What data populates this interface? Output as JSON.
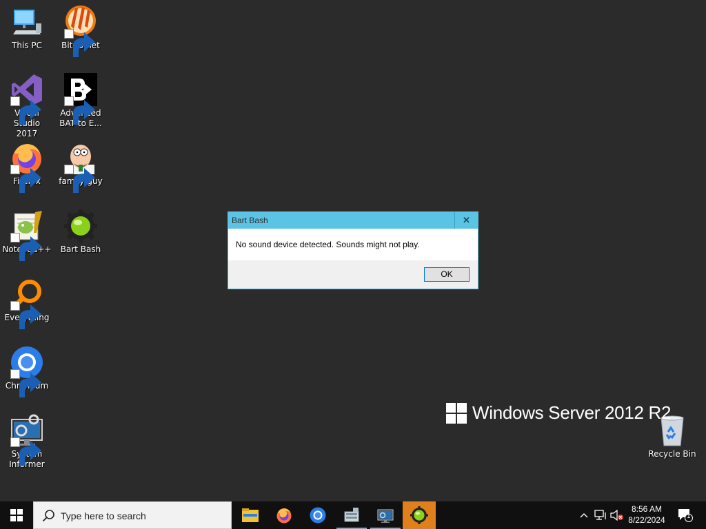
{
  "desktop": {
    "icons": [
      {
        "label": "This PC",
        "icon": "this-pc-icon"
      },
      {
        "label": "BitComet",
        "icon": "bitcomet-icon"
      },
      {
        "label": "Visual Studio\n2017",
        "icon": "visual-studio-icon"
      },
      {
        "label": "Advanced\nBAT to E...",
        "icon": "bat-to-exe-icon"
      },
      {
        "label": "Firefox",
        "icon": "firefox-icon"
      },
      {
        "label": "family-guy",
        "icon": "family-guy-icon"
      },
      {
        "label": "Notepad++",
        "icon": "notepad-plus-plus-icon"
      },
      {
        "label": "Bart Bash",
        "icon": "bart-bash-icon"
      },
      {
        "label": "Everything",
        "icon": "everything-icon"
      },
      {
        "label": "Chromium",
        "icon": "chromium-icon"
      },
      {
        "label": "System\nInformer",
        "icon": "system-informer-icon"
      },
      {
        "label": "Recycle Bin",
        "icon": "recycle-bin-icon"
      }
    ],
    "branding": "Windows Server 2012 R2"
  },
  "dialog": {
    "title": "Bart Bash",
    "close_label": "✕",
    "message": "No sound device detected. Sounds might not play.",
    "ok_label": "OK"
  },
  "taskbar": {
    "search_placeholder": "Type here to search",
    "pinned": [
      "file-explorer-icon",
      "firefox-icon",
      "chromium-icon",
      "server-manager-icon",
      "system-informer-icon",
      "bart-bash-icon"
    ],
    "time": "8:56 AM",
    "date": "8/22/2024",
    "notifications_count": "1"
  },
  "colors": {
    "desktop_bg": "#2b2b2b",
    "dialog_title_bg": "#5bc4e4",
    "taskbar_bg": "#101010",
    "active_app": "#e0801c"
  }
}
